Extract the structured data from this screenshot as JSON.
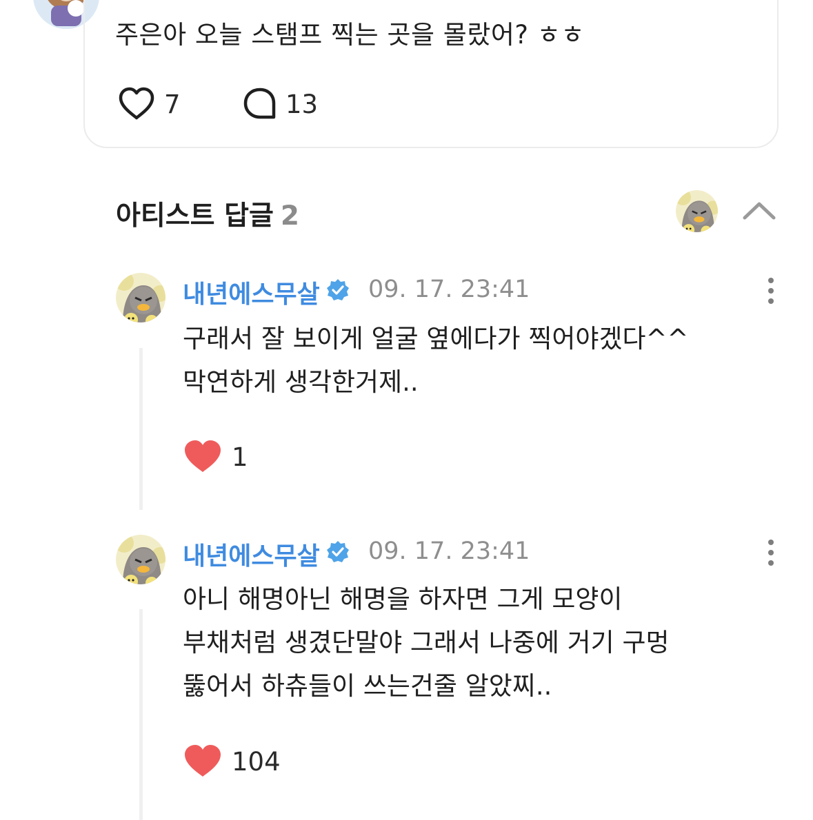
{
  "post": {
    "text": "주은아 오늘 스탬프 찍는 곳을 몰랐어? ㅎㅎ",
    "like_count": "7",
    "reply_count": "13"
  },
  "artist_replies": {
    "title": "아티스트 답글",
    "count": "2",
    "items": [
      {
        "author": "내년에스무살",
        "time": "09. 17. 23:41",
        "lines": [
          "구래서 잘 보이게 얼굴 옆에다가 찍어야겠다^^",
          "막연하게 생각한거제.."
        ],
        "likes": "1"
      },
      {
        "author": "내년에스무살",
        "time": "09. 17. 23:41",
        "lines": [
          "아니 해명아닌 해명을 하자면 그게 모양이",
          "부채처럼 생겼단말야 그래서 나중에 거기 구멍",
          "뚫어서 하츄들이 쓰는건줄 알았찌.."
        ],
        "likes": "104"
      }
    ]
  },
  "colors": {
    "accent": "#3f8be0",
    "verified": "#4fa3e8",
    "heart": "#ef5b5b",
    "muted": "#8e8e8e"
  },
  "icons": [
    "heart-outline-icon",
    "comment-bubble-icon",
    "chevron-up-icon",
    "verified-badge-icon",
    "more-vertical-icon",
    "heart-filled-icon"
  ]
}
